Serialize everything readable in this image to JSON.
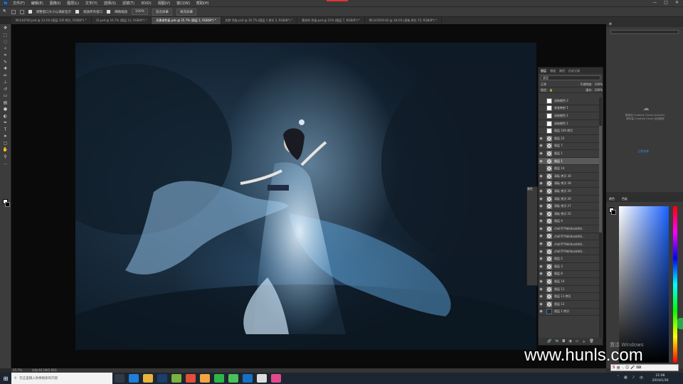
{
  "menubar": {
    "items": [
      "文件(F)",
      "编辑(E)",
      "图像(I)",
      "图层(L)",
      "文字(Y)",
      "选择(S)",
      "滤镜(T)",
      "3D(D)",
      "视图(V)",
      "窗口(W)",
      "帮助(H)"
    ],
    "win_ctrls": [
      "—",
      "□",
      "✕"
    ]
  },
  "options": {
    "resize_windows": "调整窗口大小以满屏显示",
    "zoom_all": "缩放所有窗口",
    "scrubby": "细微缩放",
    "zoom_value": "100%",
    "fit_screen": "适合屏幕",
    "fill_screen": "填充屏幕"
  },
  "doc_tabs": [
    {
      "label": "ML144740.psd @ 12.4% (图层 100 拷贝, RGB/8*) *",
      "active": false
    },
    {
      "label": "32.psd @ 16.7% (图层 12, RGB/8*) *",
      "active": false
    },
    {
      "label": "风景调色板.psb @ 25.7% (图层 1, RGB/8*) *",
      "active": true
    },
    {
      "label": "如梦 色板.psd @ 16.7% (图层 1 拷贝 2, RGB/8*) *",
      "active": false
    },
    {
      "label": "素材作 色板.psd @ 21% (图层 7, RGB/8*) *",
      "active": false
    },
    {
      "label": "ML143919-02 @ 18.4% (滴板 拷贝 15, RGB/8*) *",
      "active": false
    }
  ],
  "status": {
    "zoom": "25.7%",
    "doc": "文档:46.1M/2.95G"
  },
  "libraries": {
    "tab": "库",
    "line1": "要使用 Creative Cloud Libraries,",
    "line2": "请安装 Creative Cloud 应用程序",
    "link": "立即安装"
  },
  "color_panel": {
    "tabs": [
      "颜色",
      "色板"
    ]
  },
  "props_dock": {
    "label": "属性"
  },
  "layers": {
    "tabs": [
      "图层",
      "通道",
      "路径",
      "历史记录"
    ],
    "filter": "类型",
    "blend": "正常",
    "opacity_label": "不透明度:",
    "opacity": "100%",
    "lock_label": "锁定:",
    "fill_label": "填充:",
    "fill": "100%",
    "items": [
      {
        "name": "选取颜色 2",
        "visible": false,
        "thumb": "white"
      },
      {
        "name": "渐变映射 1",
        "visible": false,
        "thumb": "white"
      },
      {
        "name": "选取颜色 1",
        "visible": false,
        "thumb": "white"
      },
      {
        "name": "选取颜色 1",
        "visible": false,
        "thumb": "white"
      },
      {
        "name": "图层 100 拷贝",
        "visible": false,
        "thumb": "white"
      },
      {
        "name": "图层 22",
        "visible": true,
        "thumb": "check"
      },
      {
        "name": "图层 7",
        "visible": true,
        "thumb": "check"
      },
      {
        "name": "图层 1",
        "visible": true,
        "thumb": "check"
      },
      {
        "name": "图层 1",
        "visible": true,
        "thumb": "check",
        "selected": true
      },
      {
        "name": "图层 14",
        "visible": false,
        "thumb": "check"
      },
      {
        "name": "滴板 拷贝 30",
        "visible": true,
        "thumb": "check"
      },
      {
        "name": "滴板 拷贝 28",
        "visible": true,
        "thumb": "check"
      },
      {
        "name": "滴板 拷贝 29",
        "visible": true,
        "thumb": "check"
      },
      {
        "name": "滴板 拷贝 26",
        "visible": true,
        "thumb": "check"
      },
      {
        "name": "滴板 拷贝 27",
        "visible": true,
        "thumb": "check"
      },
      {
        "name": "滴板 拷贝 25",
        "visible": true,
        "thumb": "check"
      },
      {
        "name": "图层 4",
        "visible": true,
        "thumb": "check"
      },
      {
        "name": "cfa07f79b0dacbfd4...",
        "visible": true,
        "thumb": "check"
      },
      {
        "name": "cfa07f79b0dacbfd4...",
        "visible": true,
        "thumb": "check"
      },
      {
        "name": "cfa07f79b0dacbfd4...",
        "visible": true,
        "thumb": "check"
      },
      {
        "name": "cfa07f79b0dacbfd4...",
        "visible": true,
        "thumb": "check"
      },
      {
        "name": "图层 2",
        "visible": true,
        "thumb": "check"
      },
      {
        "name": "图层 3",
        "visible": true,
        "thumb": "check"
      },
      {
        "name": "图层 8",
        "visible": true,
        "thumb": "check"
      },
      {
        "name": "图层 10",
        "visible": true,
        "thumb": "check"
      },
      {
        "name": "图层 11",
        "visible": true,
        "thumb": "check"
      },
      {
        "name": "图层 11 拷贝",
        "visible": true,
        "thumb": "check"
      },
      {
        "name": "图层 13",
        "visible": true,
        "thumb": "check"
      },
      {
        "name": "图层 1 拷贝",
        "visible": true,
        "thumb": "photo"
      }
    ],
    "footer_icons": [
      "link-icon",
      "fx-icon",
      "mask-icon",
      "adjustment-icon",
      "folder-icon",
      "new-layer-icon",
      "trash-icon"
    ]
  },
  "watermark": "www.hunls.com",
  "windows_activation": "激活 Windows",
  "ime": {
    "label": "英"
  },
  "taskbar": {
    "search_placeholder": "在这里输入你要搜索的内容",
    "time": "21:08",
    "date": "2019/1/30"
  }
}
